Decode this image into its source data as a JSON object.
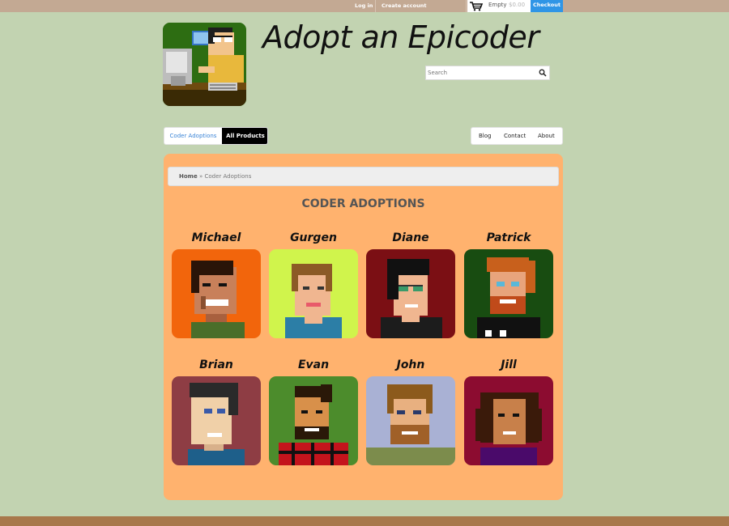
{
  "topbar": {
    "login": "Log in",
    "create_account": "Create account",
    "cart_status": "Empty",
    "cart_total": "$0.00",
    "checkout": "Checkout"
  },
  "header": {
    "title": "Adopt an Epicoder",
    "search_placeholder": "Search"
  },
  "nav": {
    "left": [
      "Coder Adoptions",
      "All Products"
    ],
    "right": [
      "Blog",
      "Contact",
      "About"
    ]
  },
  "breadcrumb": {
    "home": "Home",
    "separator": " » ",
    "current": "Coder Adoptions"
  },
  "page": {
    "heading": "CODER ADOPTIONS"
  },
  "coders": [
    {
      "name": "Michael",
      "bg": "#f2650c"
    },
    {
      "name": "Gurgen",
      "bg": "#d0f44c"
    },
    {
      "name": "Diane",
      "bg": "#7b0f14"
    },
    {
      "name": "Patrick",
      "bg": "#184c11"
    },
    {
      "name": "Brian",
      "bg": "#8e3d44"
    },
    {
      "name": "Evan",
      "bg": "#4c8c2c"
    },
    {
      "name": "John",
      "bg": "#a9b1d4"
    },
    {
      "name": "Jill",
      "bg": "#8c0c30"
    }
  ],
  "colors": {
    "page_bg": "#c2d3b1",
    "topbar_bg": "#c3a993",
    "panel_bg": "#ffb26e",
    "checkout_bg": "#2f95e6",
    "footer_bg": "#a8784b"
  }
}
